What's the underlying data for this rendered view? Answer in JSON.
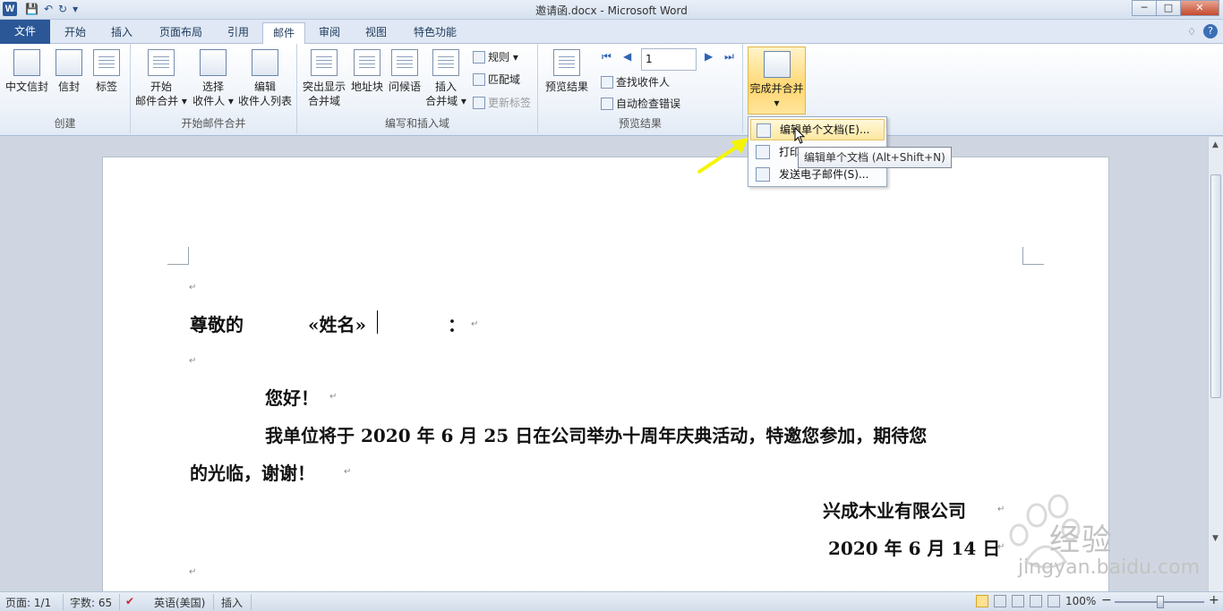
{
  "window": {
    "title": "邀请函.docx - Microsoft Word",
    "app_icon": "W",
    "controls": [
      "─",
      "□",
      "✕"
    ]
  },
  "qat": {
    "save": "💾",
    "undo": "↶",
    "redo": "↻",
    "customize": "▾"
  },
  "tabs": [
    "文件",
    "开始",
    "插入",
    "页面布局",
    "引用",
    "邮件",
    "审阅",
    "视图",
    "特色功能"
  ],
  "active_tab": "邮件",
  "help": {
    "minimize": "♢",
    "help": "?"
  },
  "ribbon": {
    "groups": {
      "create": {
        "label": "创建",
        "buttons": [
          {
            "line1": "中文信封",
            "icon": "envelope-icon"
          },
          {
            "line1": "信封",
            "icon": "envelope-icon"
          },
          {
            "line1": "标签",
            "icon": "labels-icon"
          }
        ]
      },
      "start_merge": {
        "label": "开始邮件合并",
        "buttons": [
          {
            "line1": "开始",
            "line2": "邮件合并 ▾",
            "icon": "document-icon"
          },
          {
            "line1": "选择",
            "line2": "收件人 ▾",
            "icon": "recipients-icon"
          },
          {
            "line1": "编辑",
            "line2": "收件人列表",
            "icon": "edit-list-icon"
          }
        ]
      },
      "write_insert": {
        "label": "编写和插入域",
        "buttons": [
          {
            "line1": "突出显示",
            "line2": "合并域",
            "icon": "highlight-icon"
          },
          {
            "line1": "地址块",
            "icon": "address-block-icon"
          },
          {
            "line1": "问候语",
            "icon": "greeting-icon"
          },
          {
            "line1": "插入",
            "line2": "合并域 ▾",
            "icon": "insert-field-icon"
          }
        ],
        "small": [
          {
            "label": "规则 ▾",
            "icon": "rules-icon",
            "disabled": false
          },
          {
            "label": "匹配域",
            "icon": "match-fields-icon",
            "disabled": false
          },
          {
            "label": "更新标签",
            "icon": "update-labels-icon",
            "disabled": true
          }
        ]
      },
      "preview": {
        "label": "预览结果",
        "preview_button": "预览结果",
        "nav": [
          "⏮",
          "◀",
          "▶",
          "⏭"
        ],
        "record_value": "1",
        "small": [
          {
            "label": "查找收件人",
            "icon": "find-recipient-icon"
          },
          {
            "label": "自动检查错误",
            "icon": "check-errors-icon"
          }
        ]
      },
      "finish": {
        "label": "完成",
        "button": "完成并合并",
        "caret": "▾"
      }
    }
  },
  "menu": {
    "items": [
      {
        "label": "编辑单个文档(E)...",
        "icon": "edit-documents-icon"
      },
      {
        "label": "打印",
        "icon": "print-icon"
      },
      {
        "label": "发送电子邮件(S)...",
        "icon": "email-icon"
      }
    ],
    "tooltip": "编辑单个文档 (Alt+Shift+N)"
  },
  "document": {
    "para_mark": "↵",
    "salutation_prefix": "尊敬的",
    "merge_field": "«姓名»",
    "salutation_suffix": "：",
    "greeting": "您好！",
    "body_line1": "我单位将于 2020 年 6 月 25 日在公司举办十周年庆典活动，特邀您参加，期待您",
    "body_line2": "的光临，谢谢！",
    "company": "兴成木业有限公司",
    "date": "2020 年 6 月 14 日"
  },
  "statusbar": {
    "page": "页面: 1/1",
    "words": "字数: 65",
    "language": "英语(美国)",
    "mode": "插入",
    "zoom": "100%",
    "zoom_level": 1.0,
    "zoom_minus": "−",
    "zoom_plus": "+"
  },
  "watermark": {
    "brand": "经验",
    "url": "jingyan.baidu.com"
  },
  "colors": {
    "file_tab": "#2b5797",
    "highlight": "#ffd772",
    "arrow": "#f5f500",
    "spell_underline": "#2aa52a"
  }
}
